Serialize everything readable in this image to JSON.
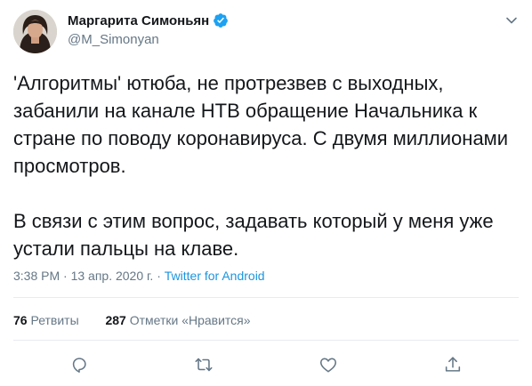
{
  "author": {
    "display_name": "Маргарита Симоньян",
    "handle": "@M_Simonyan",
    "verified": true,
    "avatar_icon": "profile-photo",
    "verified_icon": "verified-badge-icon"
  },
  "tweet": {
    "paragraphs": [
      "'Алгоритмы' ютюба, не протрезвев с выходных, забанили на канале НТВ обращение Начальника к стране по поводу коронавируса. С двумя миллионами просмотров.",
      "В связи с этим вопрос, задавать который у меня уже устали пальцы на клаве."
    ],
    "time": "3:38 PM",
    "separator": "·",
    "date": "13 апр. 2020 г.",
    "source": "Twitter for Android"
  },
  "stats": {
    "retweets_count": "76",
    "retweets_label": "Ретвиты",
    "likes_count": "287",
    "likes_label": "Отметки «Нравится»"
  },
  "actions": [
    "reply-icon",
    "retweet-icon",
    "like-icon",
    "share-icon"
  ],
  "colors": {
    "text": "#14171a",
    "secondary": "#657786",
    "accent": "#1b95e0",
    "verified": "#1da1f2",
    "divider": "#e6ecf0"
  }
}
